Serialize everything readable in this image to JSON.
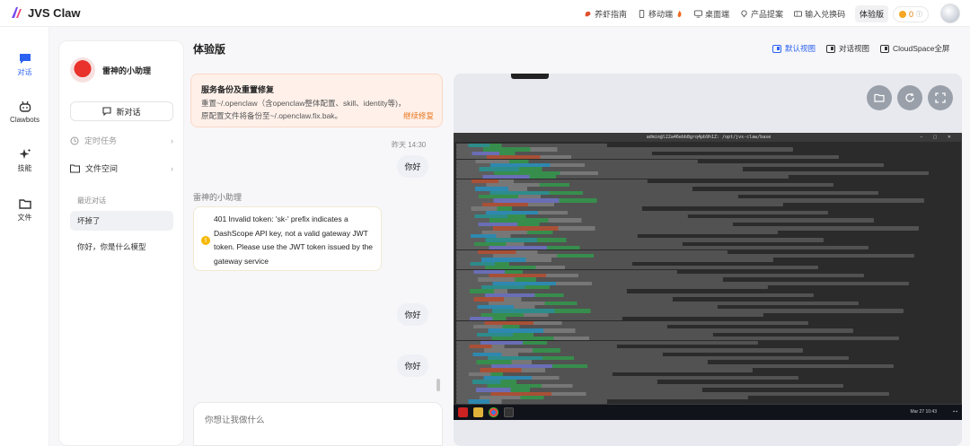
{
  "brand": {
    "name": "JVS Claw"
  },
  "topnav": [
    {
      "label": "养虾指南",
      "icon": "shrimp-icon"
    },
    {
      "label": "移动端",
      "icon": "mobile-icon"
    },
    {
      "label": "桌面端",
      "icon": "desktop-icon"
    },
    {
      "label": "产品提案",
      "icon": "lightbulb-icon"
    },
    {
      "label": "输入兑换码",
      "icon": "ticket-icon"
    }
  ],
  "account": {
    "plan": "体验版",
    "credits": "0"
  },
  "rail": [
    {
      "label": "对话",
      "icon": "chat-icon",
      "active": true
    },
    {
      "label": "Clawbots",
      "icon": "bot-icon",
      "active": false
    },
    {
      "label": "技能",
      "icon": "sparkle-icon",
      "active": false
    },
    {
      "label": "文件",
      "icon": "folder-icon",
      "active": false
    }
  ],
  "sidebar": {
    "assistant_name": "雷神的小助理",
    "new_chat": "新对话",
    "scheduled": "定时任务",
    "files": "文件空间",
    "recent_title": "最近对话",
    "recent": [
      "坏掉了",
      "你好，你是什么模型"
    ]
  },
  "chat": {
    "title": "体验版",
    "banner": {
      "title": "服务备份及重置修复",
      "body": "重置~/.openclaw（含openclaw整体配置、skill、identity等)，原配置文件将备份至~/.openclaw.fix.bak。",
      "action": "继续修复"
    },
    "timestamp": "昨天 14:30",
    "user_messages": [
      "你好",
      "你好",
      "你好"
    ],
    "bot_name": "雷神的小助理",
    "bot_message": "401 Invalid token: 'sk-' prefix indicates a DashScope API key, not a valid gateway JWT token. Please use the JWT token issued by the gateway service",
    "composer_placeholder": "你想让我做什么"
  },
  "views": [
    {
      "label": "默认视图",
      "active": true
    },
    {
      "label": "对话视图",
      "active": false
    },
    {
      "label": "CloudSpace全屏",
      "active": false
    }
  ],
  "remote": {
    "terminal_title": "admin@l22a46ebb8grq4pb9h1Z: /opt/jvs-claw/base",
    "clock": "Mar 27 10:43"
  },
  "colors": {
    "accent": "#2b62f0",
    "warning": "#e8741c",
    "credit": "#f5a623"
  }
}
